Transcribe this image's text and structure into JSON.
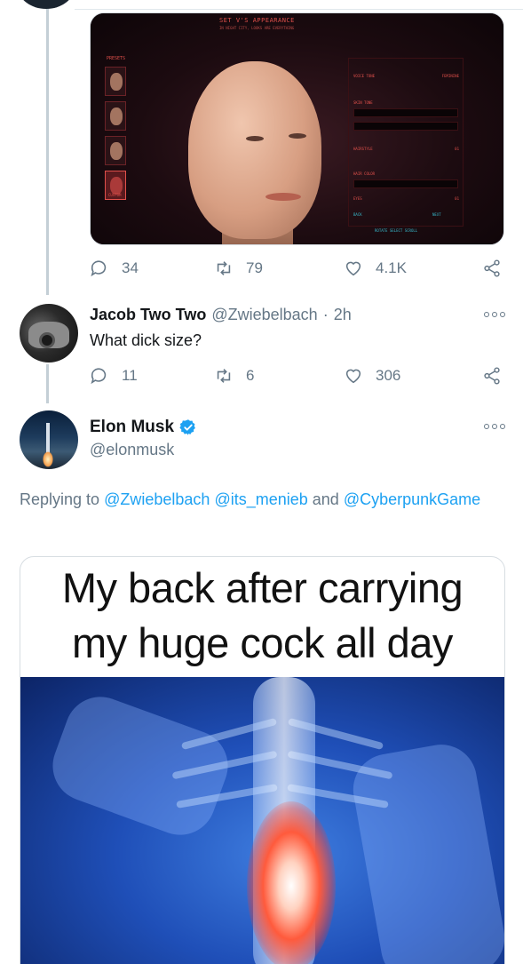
{
  "game_screenshot": {
    "header": "SET V'S APPEARANCE",
    "subheader": "IN NIGHT CITY, LOOKS ARE EVERYTHING",
    "presets_label": "PRESETS",
    "custom_preset_label": "CUSTOM",
    "panel_rows": [
      "VOICE TONE",
      "SKIN TONE",
      "HAIRSTYLE",
      "HAIR COLOR",
      "EYES"
    ],
    "voice_tone_value": "FEMININE",
    "hairstyle_value": "01",
    "eyes_value": "01",
    "back_label": "BACK",
    "next_label": "NEXT",
    "bottom_hints": "ROTATE   SELECT   SCROLL"
  },
  "first_tweet_actions": {
    "replies": "34",
    "retweets": "79",
    "likes": "4.1K"
  },
  "reply_tweet": {
    "display_name": "Jacob Two Two",
    "handle": "@Zwiebelbach",
    "separator": "·",
    "time": "2h",
    "text": "What dick size?",
    "replies": "11",
    "retweets": "6",
    "likes": "306"
  },
  "elon_tweet": {
    "display_name": "Elon Musk",
    "handle": "@elonmusk",
    "replying_prefix": "Replying to",
    "mention_1": "@Zwiebelbach",
    "mention_2": "@its_menieb",
    "and_word": "and",
    "mention_3": "@CyberpunkGame",
    "meme_caption_line1": "My back after carrying",
    "meme_caption_line2": "my huge cock all day"
  },
  "colors": {
    "link_blue": "#1da1f2",
    "secondary_gray": "#657786",
    "thread_line": "#c4cfd6",
    "verified_blue": "#1da1f2"
  }
}
